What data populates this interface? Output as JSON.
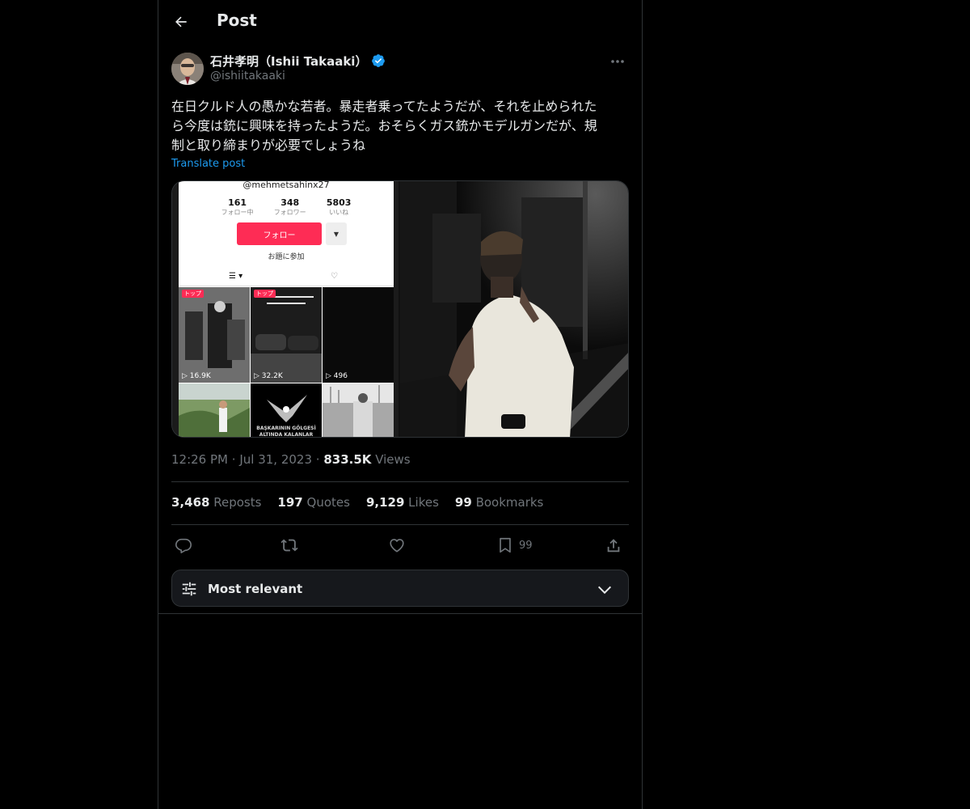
{
  "header": {
    "title": "Post"
  },
  "author": {
    "display_name": "石井孝明（Ishii Takaaki）",
    "handle": "@ishiitakaaki"
  },
  "tweet": {
    "text_lines": [
      "在日クルド人の愚かな若者。暴走者乗ってたようだが、それを止められた",
      "ら今度は銃に興味を持ったようだ。おそらくガス銃かモデルガンだが、規",
      "制と取り締まりが必要でしょうね"
    ],
    "translate_label": "Translate post"
  },
  "media": {
    "screenshot": {
      "handle": "@mehmetsahinx27",
      "stats": [
        {
          "num": "161",
          "label": "フォロー中"
        },
        {
          "num": "348",
          "label": "フォロワー"
        },
        {
          "num": "5803",
          "label": "いいね"
        }
      ],
      "follow_label": "フォロー",
      "topic_label": "お題に参加",
      "badge_label": "トップ",
      "videos": [
        {
          "views": "16.9K"
        },
        {
          "views": "32.2K"
        },
        {
          "views": "496"
        }
      ],
      "caption": "BAŞKARININ GÖLGESİ ALTINDA KALANLAR DİKKAT EDİN KARANLIK"
    }
  },
  "meta": {
    "time": "12:26 PM",
    "date": "Jul 31, 2023",
    "views_count": "833.5K",
    "views_label": "Views",
    "separator": "·"
  },
  "stats": {
    "reposts": {
      "num": "3,468",
      "label": "Reposts"
    },
    "quotes": {
      "num": "197",
      "label": "Quotes"
    },
    "likes": {
      "num": "9,129",
      "label": "Likes"
    },
    "bookmarks": {
      "num": "99",
      "label": "Bookmarks"
    }
  },
  "actions": {
    "bookmark_count": "99"
  },
  "sort": {
    "label": "Most relevant"
  },
  "colors": {
    "background": "#000000",
    "border": "#2f3336",
    "text_primary": "#e7e9ea",
    "text_secondary": "#71767b",
    "accent": "#1d9bf0",
    "tiktok_follow": "#fe2c55"
  },
  "icons": {
    "back": "arrow-left-icon",
    "verified": "verified-badge-icon",
    "more": "more-dots-icon",
    "reply": "reply-icon",
    "repost": "repost-icon",
    "like": "heart-icon",
    "bookmark": "bookmark-icon",
    "share": "share-icon",
    "sort": "sliders-icon",
    "chevron": "chevron-down-icon"
  }
}
